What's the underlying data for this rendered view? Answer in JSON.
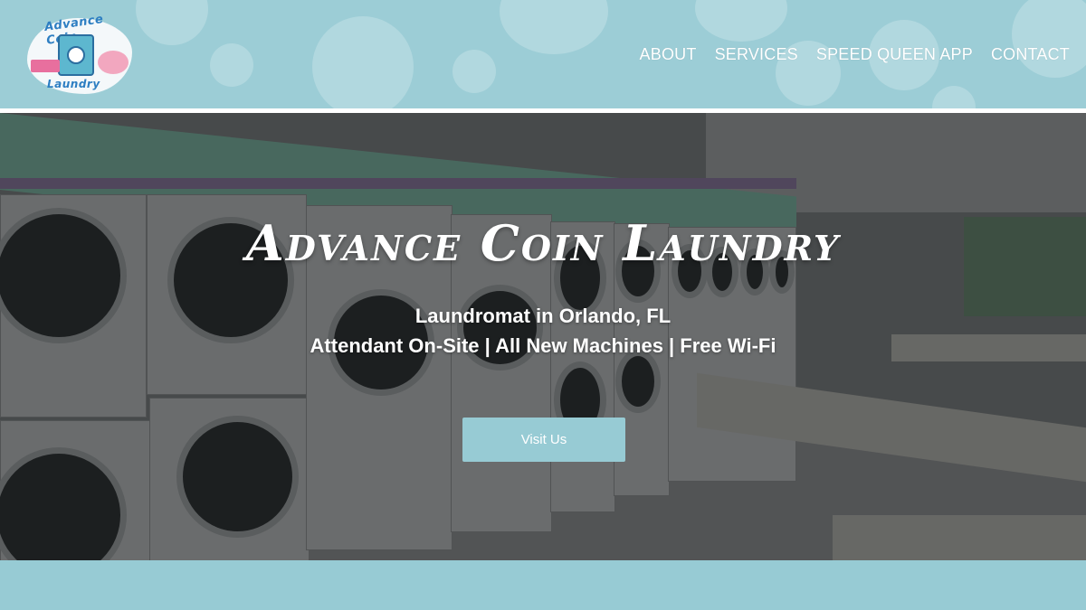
{
  "header": {
    "logo": {
      "line1": "Advance Coin",
      "line2": "Laundry"
    },
    "nav": [
      {
        "label": "ABOUT"
      },
      {
        "label": "SERVICES"
      },
      {
        "label": "SPEED QUEEN APP"
      },
      {
        "label": "CONTACT"
      }
    ]
  },
  "hero": {
    "title": "Advance Coin Laundry",
    "subtitle_line1": "Laundromat in Orlando, FL",
    "subtitle_line2": "Attendant On-Site | All New Machines | Free Wi-Fi",
    "cta_label": "Visit Us"
  },
  "colors": {
    "accent": "#97cbd4",
    "header_bg": "#9ccdd6",
    "text_light": "#ffffff"
  }
}
